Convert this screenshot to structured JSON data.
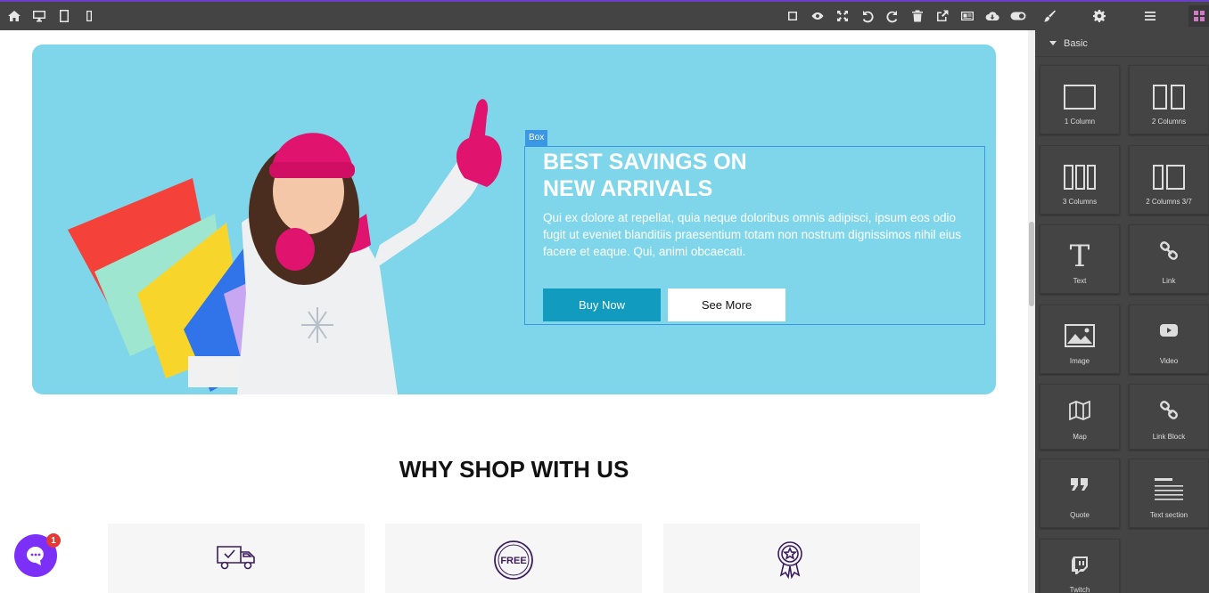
{
  "toolbar": {
    "left_icons": [
      "home-icon",
      "desktop-icon",
      "tablet-icon",
      "mobile-icon"
    ],
    "right_icons": [
      "square-outline-icon",
      "eye-icon",
      "fullscreen-icon",
      "undo-icon",
      "redo-icon",
      "trash-icon",
      "external-link-icon",
      "code-icon",
      "cloud-download-icon",
      "toggle-icon",
      "brush-icon",
      "gear-icon",
      "menu-icon",
      "blocks-icon"
    ],
    "accent": "#6c3fc7"
  },
  "hero": {
    "background": "#7fd6ea",
    "badge": "Box",
    "title": "BEST SAVINGS ON\nNEW ARRIVALS",
    "description": "Qui ex dolore at repellat, quia neque doloribus omnis adipisci, ipsum eos odio fugit ut eveniet blanditiis praesentium totam non nostrum dignissimos nihil eius facere et eaque. Qui, animi obcaecati.",
    "buy_label": "Buy Now",
    "more_label": "See More",
    "buy_color": "#119bbe"
  },
  "section": {
    "title": "WHY SHOP WITH US",
    "features": [
      {
        "icon": "delivery-truck-icon"
      },
      {
        "icon": "free-badge-icon",
        "badge_text": "FREE"
      },
      {
        "icon": "award-ribbon-icon"
      }
    ]
  },
  "chat": {
    "badge_count": "1",
    "color": "#7b2ff7"
  },
  "panel": {
    "category": "Basic",
    "blocks": [
      {
        "label": "1 Column",
        "icon": "one-column-icon"
      },
      {
        "label": "2 Columns",
        "icon": "two-columns-icon"
      },
      {
        "label": "3 Columns",
        "icon": "three-columns-icon"
      },
      {
        "label": "2 Columns 3/7",
        "icon": "two-columns-37-icon"
      },
      {
        "label": "Text",
        "icon": "text-icon"
      },
      {
        "label": "Link",
        "icon": "link-icon"
      },
      {
        "label": "Image",
        "icon": "image-icon"
      },
      {
        "label": "Video",
        "icon": "video-icon"
      },
      {
        "label": "Map",
        "icon": "map-icon"
      },
      {
        "label": "Link Block",
        "icon": "link-block-icon"
      },
      {
        "label": "Quote",
        "icon": "quote-icon"
      },
      {
        "label": "Text section",
        "icon": "text-section-icon"
      },
      {
        "label": "Twitch",
        "icon": "twitch-icon"
      }
    ]
  }
}
